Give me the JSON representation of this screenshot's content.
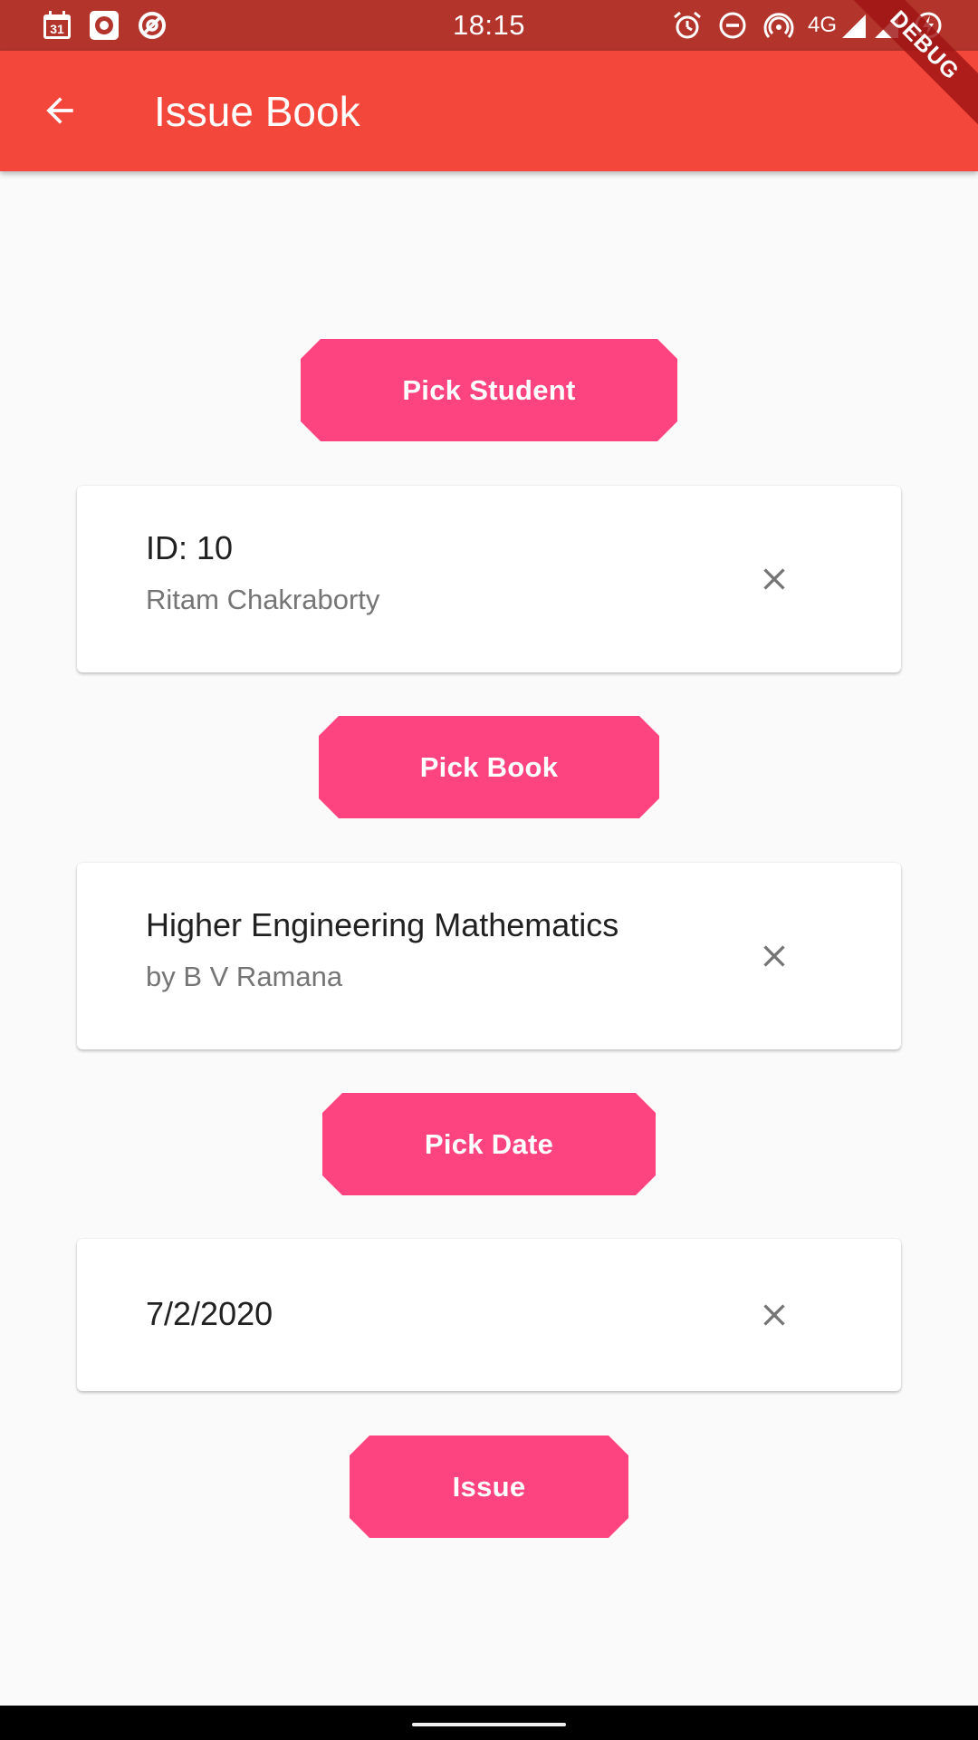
{
  "status_bar": {
    "time": "18:15",
    "network": "4G",
    "left_icons": [
      "calendar-icon",
      "record-icon",
      "at-sign-icon"
    ],
    "right_icons": [
      "alarm-icon",
      "do-not-disturb-icon",
      "hotspot-icon",
      "signal-icon",
      "signal-icon",
      "battery-charging-icon"
    ],
    "calendar_day": "31"
  },
  "debug_banner": {
    "label": "DEBUG"
  },
  "app_bar": {
    "title": "Issue Book",
    "back_icon": "arrow-back-icon",
    "color": "#f4473b"
  },
  "student_section": {
    "button_label": "Pick Student",
    "id_text": "ID: 10",
    "name": "Ritam Chakraborty",
    "clear_icon": "close-icon"
  },
  "book_section": {
    "button_label": "Pick Book",
    "title": "Higher Engineering Mathematics",
    "author": "by B V Ramana",
    "clear_icon": "close-icon"
  },
  "date_section": {
    "button_label": "Pick Date",
    "date": "7/2/2020",
    "clear_icon": "close-icon"
  },
  "issue_button": {
    "label": "Issue"
  },
  "colors": {
    "accent": "#fe4480",
    "status_bar": "#b3342b",
    "background": "#fafafa"
  }
}
